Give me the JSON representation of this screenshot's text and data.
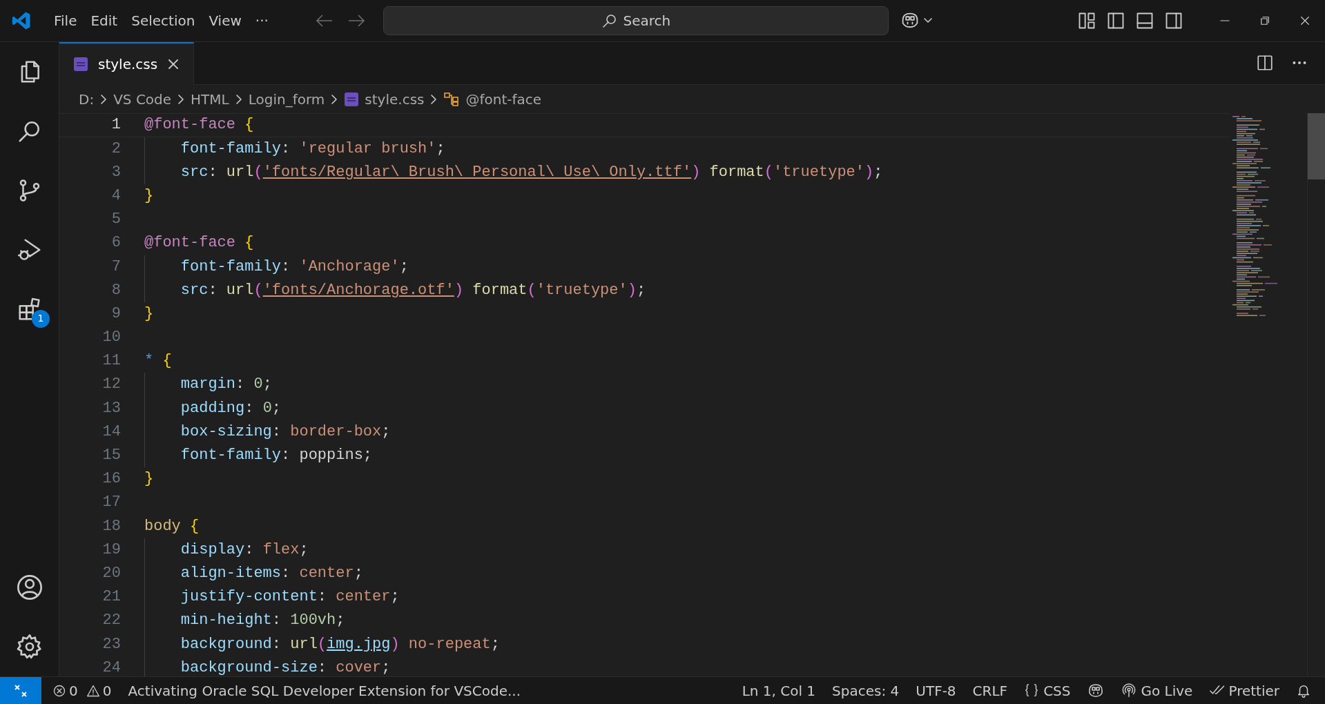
{
  "title_bar": {
    "menu": [
      "File",
      "Edit",
      "Selection",
      "View",
      "···"
    ],
    "search": {
      "placeholder": "Search"
    }
  },
  "activity_bar": {
    "extensions_badge": "1"
  },
  "tabs": [
    {
      "label": "style.css",
      "selected": true
    }
  ],
  "breadcrumbs": [
    "D:",
    "VS Code",
    "HTML",
    "Login_form",
    "style.css",
    "@font-face"
  ],
  "editor": {
    "lines": [
      {
        "number": "1",
        "current": true,
        "indented": false,
        "tokens": [
          {
            "kind": "at",
            "text": "@font-face"
          },
          {
            "kind": "brace",
            "text": " {"
          }
        ]
      },
      {
        "number": "2",
        "current": false,
        "indented": true,
        "tokens": [
          {
            "kind": "prop",
            "text": "font-family"
          },
          {
            "kind": "punct",
            "text": ": "
          },
          {
            "kind": "str",
            "text": "'regular brush'"
          },
          {
            "kind": "punct",
            "text": ";"
          }
        ]
      },
      {
        "number": "3",
        "current": false,
        "indented": true,
        "tokens": [
          {
            "kind": "prop",
            "text": "src"
          },
          {
            "kind": "punct",
            "text": ": "
          },
          {
            "kind": "func",
            "text": "url"
          },
          {
            "kind": "paren",
            "text": "("
          },
          {
            "kind": "link",
            "text": "'fonts/Regular\\ Brush\\ Personal\\ Use\\ Only.ttf'"
          },
          {
            "kind": "paren",
            "text": ")"
          },
          {
            "kind": "func",
            "text": " format"
          },
          {
            "kind": "paren",
            "text": "("
          },
          {
            "kind": "str",
            "text": "'truetype'"
          },
          {
            "kind": "paren",
            "text": ")"
          },
          {
            "kind": "punct",
            "text": ";"
          }
        ]
      },
      {
        "number": "4",
        "current": false,
        "indented": false,
        "tokens": [
          {
            "kind": "brace",
            "text": "}"
          }
        ]
      },
      {
        "number": "5",
        "current": false
      },
      {
        "number": "6",
        "current": false,
        "indented": false,
        "tokens": [
          {
            "kind": "at",
            "text": "@font-face"
          },
          {
            "kind": "brace",
            "text": " {"
          }
        ]
      },
      {
        "number": "7",
        "current": false,
        "indented": true,
        "tokens": [
          {
            "kind": "prop",
            "text": "font-family"
          },
          {
            "kind": "punct",
            "text": ": "
          },
          {
            "kind": "str",
            "text": "'Anchorage'"
          },
          {
            "kind": "punct",
            "text": ";"
          }
        ]
      },
      {
        "number": "8",
        "current": false,
        "indented": true,
        "tokens": [
          {
            "kind": "prop",
            "text": "src"
          },
          {
            "kind": "punct",
            "text": ": "
          },
          {
            "kind": "func",
            "text": "url"
          },
          {
            "kind": "paren",
            "text": "("
          },
          {
            "kind": "link",
            "text": "'fonts/Anchorage.otf'"
          },
          {
            "kind": "paren",
            "text": ")"
          },
          {
            "kind": "func",
            "text": " format"
          },
          {
            "kind": "paren",
            "text": "("
          },
          {
            "kind": "str",
            "text": "'truetype'"
          },
          {
            "kind": "paren",
            "text": ")"
          },
          {
            "kind": "punct",
            "text": ";"
          }
        ]
      },
      {
        "number": "9",
        "current": false,
        "indented": false,
        "tokens": [
          {
            "kind": "brace",
            "text": "}"
          }
        ]
      },
      {
        "number": "10",
        "current": false
      },
      {
        "number": "11",
        "current": false,
        "indented": false,
        "tokens": [
          {
            "kind": "star",
            "text": "*"
          },
          {
            "kind": "brace",
            "text": " {"
          }
        ]
      },
      {
        "number": "12",
        "current": false,
        "indented": true,
        "tokens": [
          {
            "kind": "prop",
            "text": "margin"
          },
          {
            "kind": "punct",
            "text": ": "
          },
          {
            "kind": "num",
            "text": "0"
          },
          {
            "kind": "punct",
            "text": ";"
          }
        ]
      },
      {
        "number": "13",
        "current": false,
        "indented": true,
        "tokens": [
          {
            "kind": "prop",
            "text": "padding"
          },
          {
            "kind": "punct",
            "text": ": "
          },
          {
            "kind": "num",
            "text": "0"
          },
          {
            "kind": "punct",
            "text": ";"
          }
        ]
      },
      {
        "number": "14",
        "current": false,
        "indented": true,
        "tokens": [
          {
            "kind": "prop",
            "text": "box-sizing"
          },
          {
            "kind": "punct",
            "text": ": "
          },
          {
            "kind": "val",
            "text": "border-box"
          },
          {
            "kind": "punct",
            "text": ";"
          }
        ]
      },
      {
        "number": "15",
        "current": false,
        "indented": true,
        "tokens": [
          {
            "kind": "prop",
            "text": "font-family"
          },
          {
            "kind": "punct",
            "text": ": poppins;"
          }
        ]
      },
      {
        "number": "16",
        "current": false,
        "indented": false,
        "tokens": [
          {
            "kind": "brace",
            "text": "}"
          }
        ]
      },
      {
        "number": "17",
        "current": false
      },
      {
        "number": "18",
        "current": false,
        "indented": false,
        "tokens": [
          {
            "kind": "tag",
            "text": "body"
          },
          {
            "kind": "brace",
            "text": " {"
          }
        ]
      },
      {
        "number": "19",
        "current": false,
        "indented": true,
        "tokens": [
          {
            "kind": "prop",
            "text": "display"
          },
          {
            "kind": "punct",
            "text": ": "
          },
          {
            "kind": "val",
            "text": "flex"
          },
          {
            "kind": "punct",
            "text": ";"
          }
        ]
      },
      {
        "number": "20",
        "current": false,
        "indented": true,
        "tokens": [
          {
            "kind": "prop",
            "text": "align-items"
          },
          {
            "kind": "punct",
            "text": ": "
          },
          {
            "kind": "val",
            "text": "center"
          },
          {
            "kind": "punct",
            "text": ";"
          }
        ]
      },
      {
        "number": "21",
        "current": false,
        "indented": true,
        "tokens": [
          {
            "kind": "prop",
            "text": "justify-content"
          },
          {
            "kind": "punct",
            "text": ": "
          },
          {
            "kind": "val",
            "text": "center"
          },
          {
            "kind": "punct",
            "text": ";"
          }
        ]
      },
      {
        "number": "22",
        "current": false,
        "indented": true,
        "tokens": [
          {
            "kind": "prop",
            "text": "min-height"
          },
          {
            "kind": "punct",
            "text": ": "
          },
          {
            "kind": "num",
            "text": "100vh"
          },
          {
            "kind": "punct",
            "text": ";"
          }
        ]
      },
      {
        "number": "23",
        "current": false,
        "indented": true,
        "tokens": [
          {
            "kind": "prop",
            "text": "background"
          },
          {
            "kind": "punct",
            "text": ": "
          },
          {
            "kind": "func",
            "text": "url"
          },
          {
            "kind": "paren",
            "text": "("
          },
          {
            "kind": "plainlink",
            "text": "img.jpg"
          },
          {
            "kind": "paren",
            "text": ")"
          },
          {
            "kind": "val",
            "text": " no-repeat"
          },
          {
            "kind": "punct",
            "text": ";"
          }
        ]
      },
      {
        "number": "24",
        "current": false,
        "indented": true,
        "tokens": [
          {
            "kind": "prop",
            "text": "background-size"
          },
          {
            "kind": "punct",
            "text": ": "
          },
          {
            "kind": "val",
            "text": "cover"
          },
          {
            "kind": "punct",
            "text": ";"
          }
        ]
      }
    ]
  },
  "status_bar": {
    "errors": "0",
    "warnings": "0",
    "message": "Activating Oracle SQL Developer Extension for VSCode...",
    "items": [
      "Ln 1, Col 1",
      "Spaces: 4",
      "UTF-8",
      "CRLF",
      "CSS",
      "Go Live",
      "Prettier"
    ]
  }
}
